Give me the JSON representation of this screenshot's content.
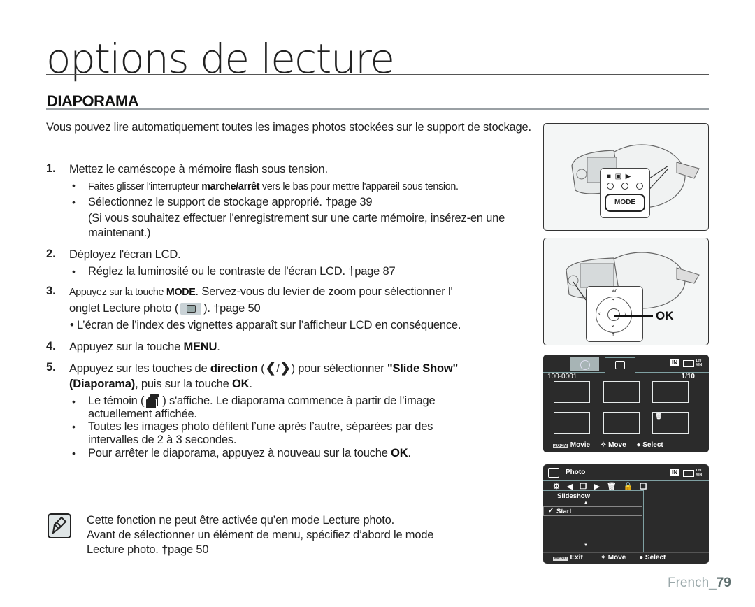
{
  "page": {
    "title": "options de lecture",
    "section_title": "DIAPORAMA",
    "intro": "Vous pouvez lire automatiquement toutes les images photos stockées sur le support de stockage.",
    "steps": [
      {
        "num": "1.",
        "text": "Mettez le caméscope à mémoire flash sous tension.",
        "bullets": [
          {
            "pre": "Faites glisser l'interrupteur ",
            "bold": "marche/arrêt",
            "post": " vers le bas pour mettre l'appareil sous tension."
          },
          {
            "pre": "Sélectionnez le support de stockage approprié.  †page 39",
            "bold": "",
            "post": ""
          }
        ],
        "extra": "(Si vous souhaitez effectuer l'enregistrement sur une carte mémoire, insérez-en une maintenant.)"
      },
      {
        "num": "2.",
        "text": "Déployez l'écran LCD.",
        "bullets": [
          {
            "pre": "Réglez la luminosité ou le contraste de l'écran LCD.  †page 87",
            "bold": "",
            "post": ""
          }
        ]
      },
      {
        "num": "3.",
        "pre": "Appuyez sur la touche ",
        "bold": "MODE",
        "post": ". Servez-vous du levier de zoom pour sélectionner l'",
        "line2_pre": "onglet Lecture photo (",
        "line2_post": "). †page 50",
        "bullets": [
          {
            "pre": "L’écran de l’index des vignettes apparaît sur l’afficheur LCD en conséquence.",
            "bold": "",
            "post": ""
          }
        ]
      },
      {
        "num": "4.",
        "pre": "Appuyez sur la touche ",
        "bold": "MENU",
        "post": "."
      },
      {
        "num": "5.",
        "pre": "Appuyez sur les touches de ",
        "bold": "direction",
        "paren_open": " (",
        "slash": "/",
        "paren_close": ") pour sélectionner ",
        "bold2": "\"Slide Show\"",
        "line2_bold": "(Diaporama)",
        "line2_mid": ", puis sur la touche ",
        "line2_bold2": "OK",
        "line2_end": ".",
        "bullets": [
          {
            "pre": "Le témoin (",
            "post": ") s'affiche. Le diaporama commence à partir de l’image",
            "line2": "actuellement affichée."
          },
          {
            "pre": "Toutes les images photo défilent l’une après l’autre, séparées par des",
            "line2": "intervalles de 2 à 3 secondes."
          },
          {
            "pre": "Pour arrêter le diaporama, appuyez à nouveau sur la touche ",
            "bold": "OK",
            "post": "."
          }
        ]
      }
    ],
    "note": {
      "lines": [
        "Cette fonction ne peut être activée qu’en mode Lecture photo.",
        "Avant de sélectionner un élément de menu, spécifiez d’abord le mode",
        "Lecture photo.  †page 50"
      ]
    },
    "footer": {
      "lang": "French_",
      "page": "79"
    }
  },
  "figures": {
    "fig1": {
      "button_label": "MODE"
    },
    "fig2": {
      "ok_label": "OK",
      "w_label": "W",
      "t_label": "T"
    },
    "lcd1": {
      "file_id": "100-0001",
      "counter": "1/10",
      "storage": "IN",
      "time": "120 MIN",
      "footer": [
        {
          "key": "ZOOM",
          "label": "Movie"
        },
        {
          "key": "move",
          "label": "Move"
        },
        {
          "key": "ok",
          "label": "Select"
        }
      ]
    },
    "lcd2": {
      "title": "Photo",
      "storage": "IN",
      "time": "120 MIN",
      "menu_title": "Slideshow",
      "item": "Start",
      "footer": [
        {
          "key": "MENU",
          "label": "Exit"
        },
        {
          "key": "move",
          "label": "Move"
        },
        {
          "key": "ok",
          "label": "Select"
        }
      ]
    }
  },
  "colors": {
    "accent_rule": "#9aa0a4",
    "lcd_bg": "#2b2b2b",
    "lcd_line": "#6f8f90",
    "footer_text": "#9aa8aa"
  }
}
